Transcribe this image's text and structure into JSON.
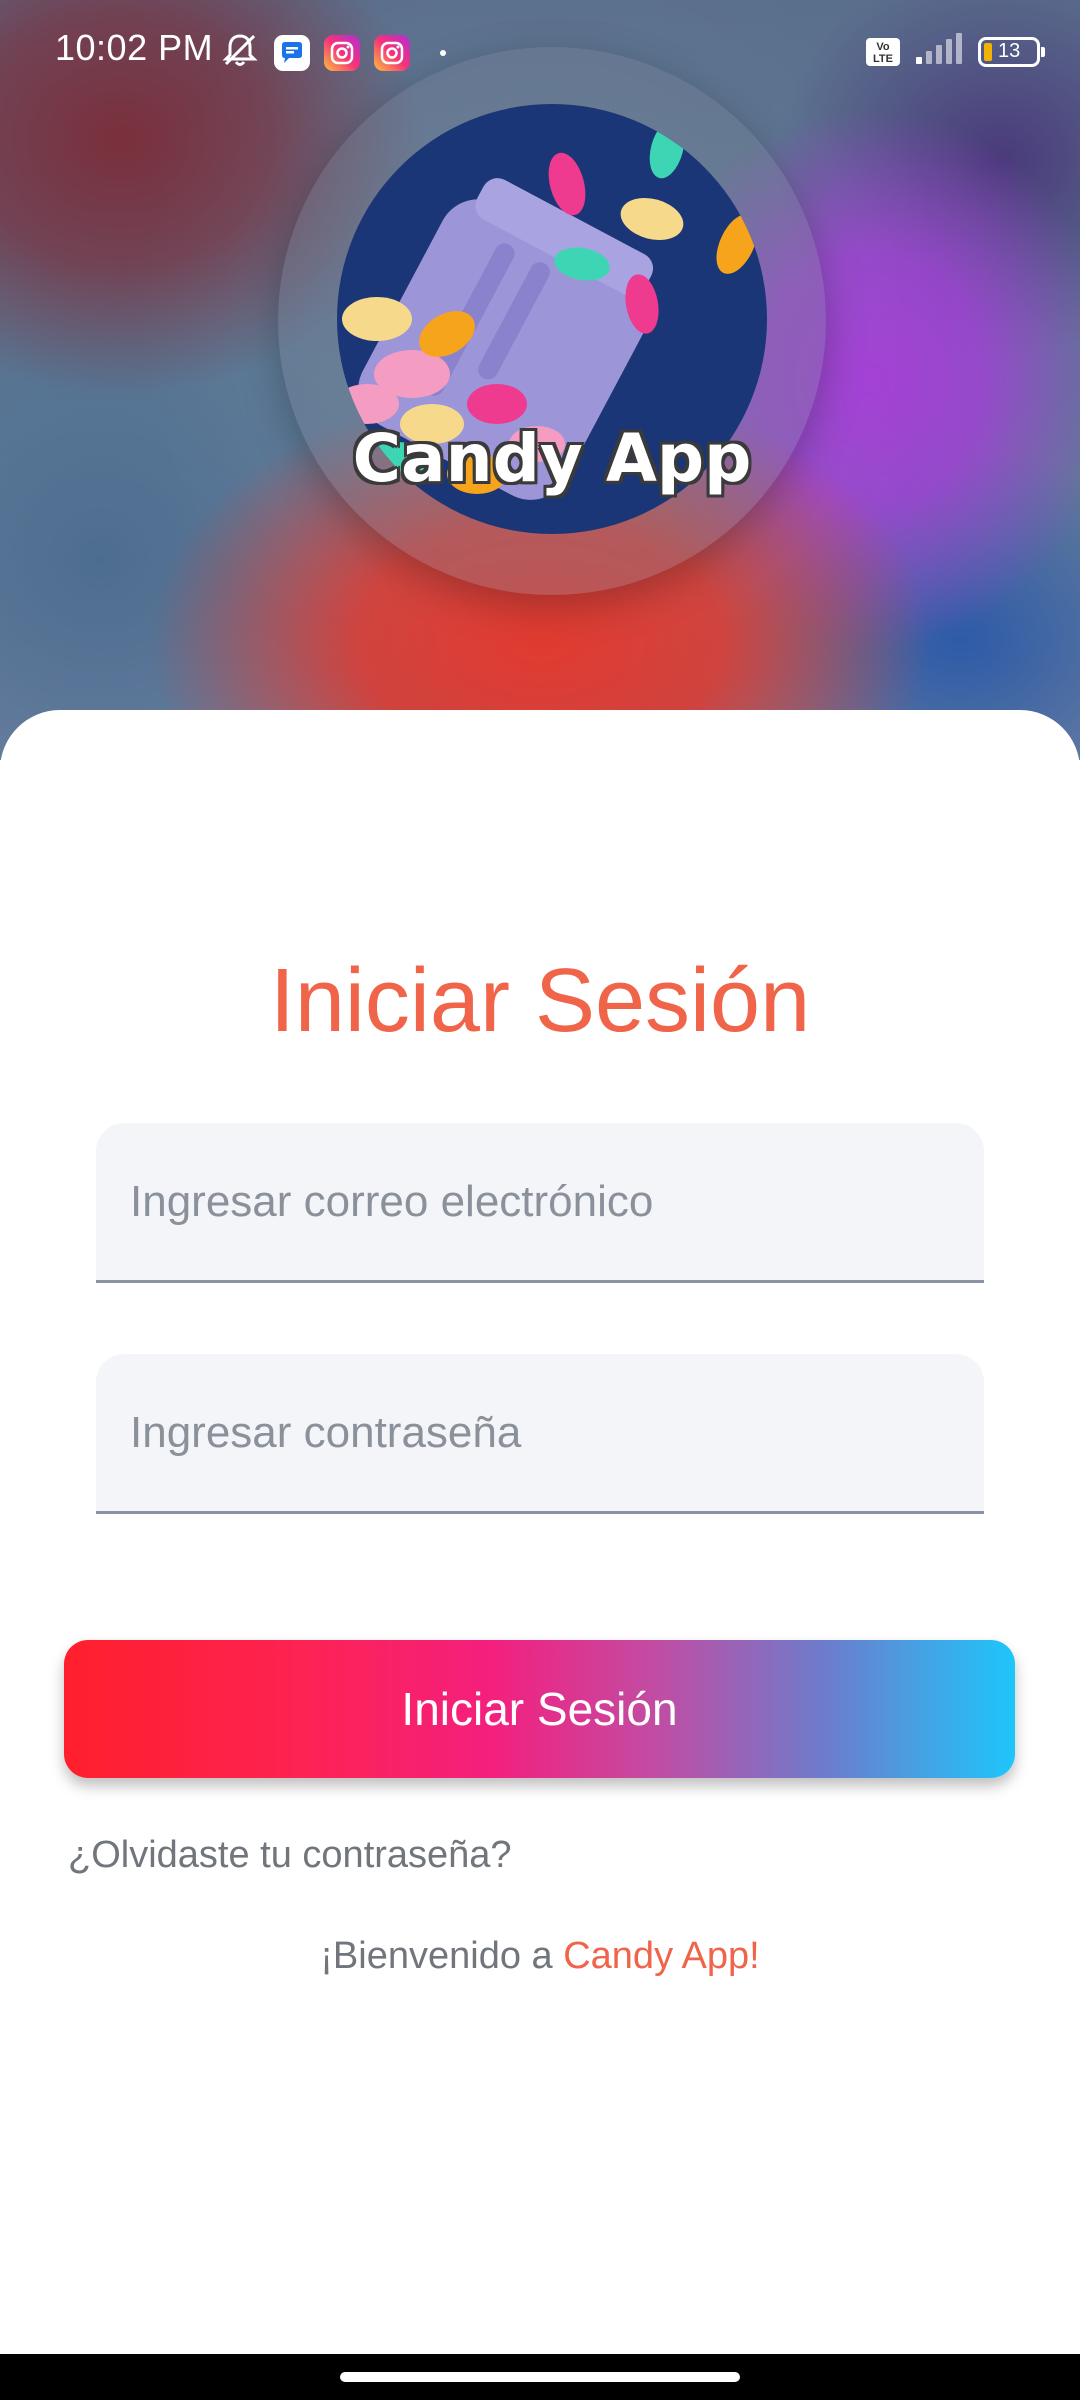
{
  "status_bar": {
    "time": "10:02 PM",
    "battery_level": "13",
    "volte_label": "Vo\nLTE",
    "icons": [
      "mute-icon",
      "messages-icon",
      "instagram-icon",
      "instagram-icon",
      "notification-dot",
      "volte-icon",
      "signal-icon",
      "battery-icon"
    ]
  },
  "logo": {
    "text": "Candy App"
  },
  "login": {
    "title": "Iniciar Sesión",
    "email_placeholder": "Ingresar correo electrónico",
    "email_value": "",
    "password_placeholder": "Ingresar contraseña",
    "password_value": "",
    "submit_label": "Iniciar Sesión",
    "forgot_password": "¿Olvidaste tu contraseña?",
    "welcome_prefix": "¡Bienvenido a ",
    "welcome_brand": "Candy App!"
  },
  "colors": {
    "accent": "#f0644a",
    "button_gradient_start": "#ff1f2c",
    "button_gradient_mid": "#f41f7e",
    "button_gradient_end": "#1ec6fb",
    "logo_bg": "#1b3676"
  }
}
